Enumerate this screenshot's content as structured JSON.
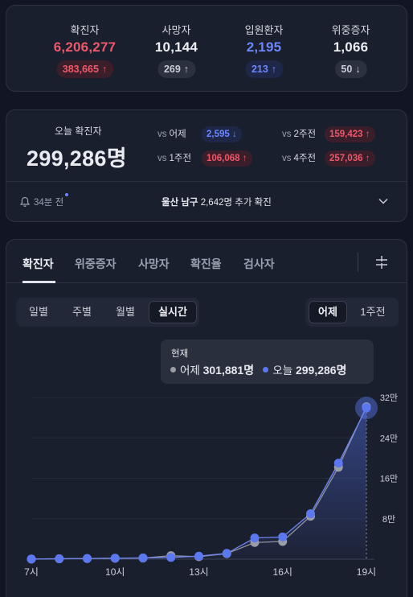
{
  "stats": [
    {
      "label": "확진자",
      "value": "6,206,277",
      "change": "383,665",
      "dir": "↑",
      "color": "red",
      "badge": "bg-red"
    },
    {
      "label": "사망자",
      "value": "10,144",
      "change": "269",
      "dir": "↑",
      "color": "white",
      "badge": "bg-gray"
    },
    {
      "label": "입원환자",
      "value": "2,195",
      "change": "213",
      "dir": "↑",
      "color": "blue",
      "badge": "bg-blue"
    },
    {
      "label": "위중증자",
      "value": "1,066",
      "change": "50",
      "dir": "↓",
      "color": "white",
      "badge": "bg-gray"
    }
  ],
  "today": {
    "label": "오늘 확진자",
    "value": "299,286명",
    "comparisons": [
      {
        "vs": "vs",
        "name": "어제",
        "value": "2,595",
        "dir": "↓",
        "style": "bg-blue"
      },
      {
        "vs": "vs",
        "name": "2주전",
        "value": "159,423",
        "dir": "↑",
        "style": "bg-red"
      },
      {
        "vs": "vs",
        "name": "1주전",
        "value": "106,068",
        "dir": "↑",
        "style": "bg-red"
      },
      {
        "vs": "vs",
        "name": "4주전",
        "value": "257,036",
        "dir": "↑",
        "style": "bg-red"
      }
    ],
    "ago": "34분 전",
    "news_place": "울산 남구",
    "news_text": " 2,642명 추가 확진"
  },
  "tabs": [
    "확진자",
    "위중증자",
    "사망자",
    "확진율",
    "검사자"
  ],
  "periods": [
    "일별",
    "주별",
    "월별",
    "실시간"
  ],
  "compare": [
    "어제",
    "1주전"
  ],
  "tooltip": {
    "title": "현재",
    "yesterday_label": "어제",
    "yesterday_value": "301,881명",
    "today_label": "오늘",
    "today_value": "299,286명"
  },
  "colors": {
    "today": "#5b78f0",
    "yesterday": "#9a9ca6",
    "red": "#f0566a",
    "blue": "#6b86ff"
  },
  "chart_data": {
    "type": "line",
    "x": [
      "7시",
      "8시",
      "9시",
      "10시",
      "11시",
      "12시",
      "13시",
      "14시",
      "15시",
      "16시",
      "17시",
      "18시",
      "19시"
    ],
    "xticks": [
      "7시",
      "10시",
      "13시",
      "16시",
      "19시"
    ],
    "yticks": [
      "8만",
      "16만",
      "24만",
      "32만"
    ],
    "ylim": [
      0,
      320000
    ],
    "series": [
      {
        "name": "어제",
        "values": [
          200,
          800,
          1200,
          1800,
          2200,
          7000,
          5000,
          11000,
          33000,
          35000,
          85000,
          182000,
          301881
        ]
      },
      {
        "name": "오늘",
        "values": [
          300,
          900,
          1400,
          2000,
          2500,
          3500,
          6000,
          11500,
          42000,
          44000,
          90000,
          190000,
          299286
        ]
      }
    ]
  }
}
